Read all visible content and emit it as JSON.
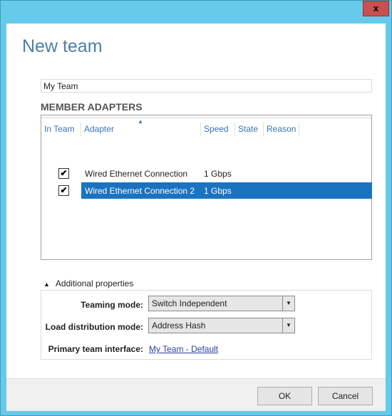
{
  "window": {
    "close_label": "x"
  },
  "dialog": {
    "title": "New team",
    "team_name_value": "My Team",
    "team_name_placeholder": ""
  },
  "member_adapters": {
    "section_title": "MEMBER ADAPTERS",
    "columns": [
      "In Team",
      "Adapter",
      "Speed",
      "State",
      "Reason"
    ],
    "sort_indicator": "▲",
    "rows": [
      {
        "in_team": true,
        "check": "✔",
        "adapter": "Wired Ethernet Connection",
        "speed": "1 Gbps",
        "state": "",
        "reason": "",
        "selected": false
      },
      {
        "in_team": true,
        "check": "✔",
        "adapter": "Wired Ethernet Connection 2",
        "speed": "1 Gbps",
        "state": "",
        "reason": "",
        "selected": true
      }
    ]
  },
  "additional_properties": {
    "toggle_icon": "▲",
    "toggle_label": "Additional properties",
    "teaming_mode_label": "Teaming mode:",
    "teaming_mode_value": "Switch Independent",
    "load_distribution_label": "Load distribution mode:",
    "load_distribution_value": "Address Hash",
    "primary_interface_label": "Primary team interface:",
    "primary_interface_link": "My Team - Default",
    "dropdown_icon": "▼"
  },
  "footer": {
    "ok_label": "OK",
    "cancel_label": "Cancel"
  },
  "colors": {
    "titlebar": "#66caea",
    "close_button": "#c75050",
    "selection": "#1a73c0",
    "header_text": "#3a73b5",
    "title_text": "#4e7fa6",
    "link": "#2a3fa5"
  }
}
